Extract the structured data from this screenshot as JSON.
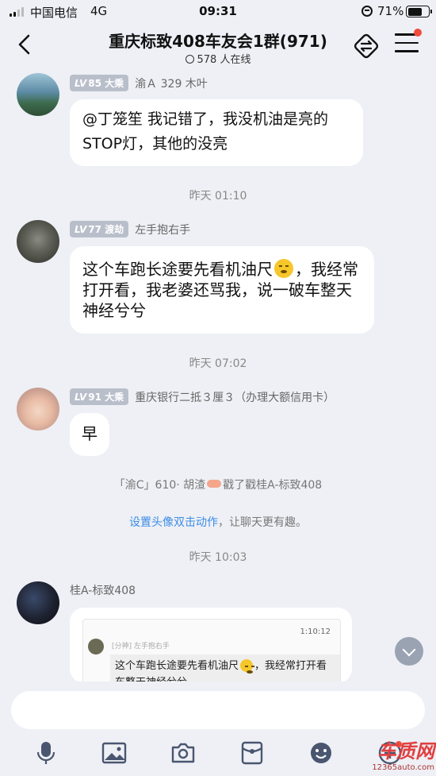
{
  "status_bar": {
    "carrier": "中国电信",
    "network": "4G",
    "time": "09:31",
    "battery": "71%"
  },
  "header": {
    "title": "重庆标致408车友会1群(971)",
    "online": "578 人在线"
  },
  "messages": [
    {
      "level": "LV",
      "level_num": "85",
      "rank": "大乘",
      "sender": "渝Ａ 329 木叶",
      "text": "@丁笼笙 我记错了，我没机油是亮的STOP灯，其他的没亮"
    },
    {
      "level": "LV",
      "level_num": "77",
      "rank": "渡劫",
      "sender": "左手抱右手",
      "text_before": "这个车跑长途要先看机油尺",
      "text_after": "，我经常打开看，我老婆还骂我，说一破车整天神经兮兮"
    },
    {
      "level": "LV",
      "level_num": "91",
      "rank": "大乘",
      "sender": "重庆银行二抵３厘３（办理大额信用卡）",
      "text": "早"
    },
    {
      "sender": "桂A-标致408"
    }
  ],
  "times": [
    "昨天 01:10",
    "昨天 07:02",
    "昨天 10:03"
  ],
  "system": {
    "poke_before": "「渝C」610· 胡渣",
    "poke_after": "戳了戳桂A-标致408",
    "tip_link": "设置头像双击动作",
    "tip_rest": "，让聊天更有趣。"
  },
  "quote": {
    "time": "1:10:12",
    "name": "[分神] 左手抱右手",
    "text_before": "这个车跑长途要先看机油尺",
    "text_after": "，我经常打开看车整天神经兮兮"
  },
  "watermark": {
    "big": "车质网",
    "small": "12365auto.com"
  },
  "toolbar": [
    "mic-icon",
    "image-icon",
    "camera-icon",
    "redpacket-icon",
    "emoji-icon",
    "plus-icon"
  ]
}
